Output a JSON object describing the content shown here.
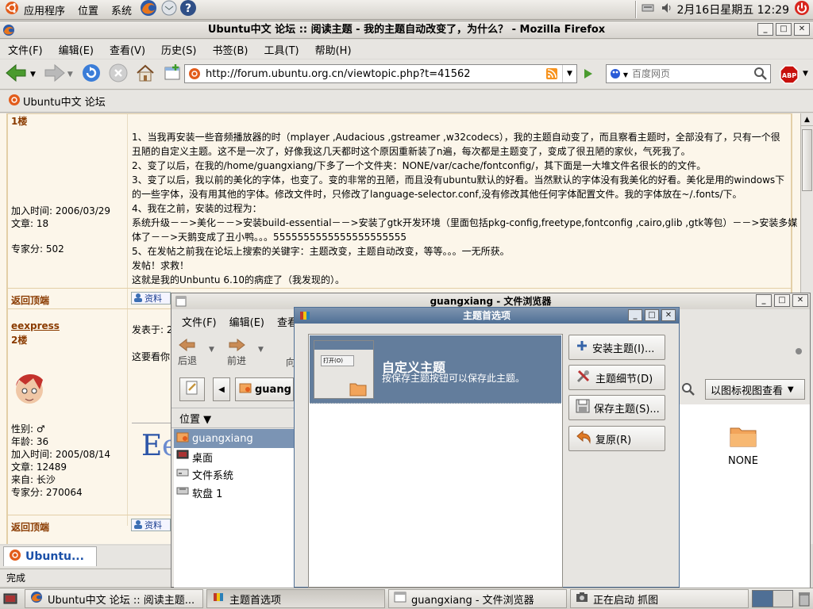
{
  "top_panel": {
    "menu_apps": "应用程序",
    "menu_places": "位置",
    "menu_system": "系统",
    "clock": "2月16日星期五 12:29"
  },
  "firefox": {
    "title": "Ubuntu中文 论坛 :: 阅读主题 - 我的主题自动改变了，为什么？ - Mozilla Firefox",
    "menus": [
      "文件(F)",
      "编辑(E)",
      "查看(V)",
      "历史(S)",
      "书签(B)",
      "工具(T)",
      "帮助(H)"
    ],
    "url": "http://forum.ubuntu.org.cn/viewtopic.php?t=41562",
    "search_placeholder": "百度网页",
    "bookmark": "Ubuntu中文 论坛",
    "tab_label": "Ubuntu...",
    "status": "完成"
  },
  "forum": {
    "post1": {
      "floor": "1楼",
      "join": "加入时间: 2006/03/29",
      "posts": "文章: 18",
      "score": "专家分: 502",
      "lines": [
        "1、当我再安装一些音频播放器的时（mplayer ,Audacious ,gstreamer ,w32codecs），我的主题自动变了，而且察看主题时，全部没有了，只有一个很",
        "丑陋的自定义主题。这不是一次了，好像我这几天都时这个原因重新装了n遍，每次都是主题变了，变成了很丑陋的家伙，气死我了。",
        "2、变了以后，在我的/home/guangxiang/下多了一个文件夹：NONE/var/cache/fontconfig/，其下面是一大堆文件名很长的的文件。",
        "3、变了以后，我以前的美化的字体，也变了。变的非常的丑陋，而且没有ubuntu默认的好看。当然默认的字体没有我美化的好看。美化是用的windows下",
        "的一些字体，没有用其他的字体。修改文件时，只修改了language-selector.conf,没有修改其他任何字体配置文件。我的字体放在~/.fonts/下。",
        "4、我在之前，安装的过程为：",
        "系统升级－－>美化－－>安装build-essential－－>安装了gtk开发环境（里面包括pkg-config,freetype,fontconfig ,cairo,glib ,gtk等包）－－>安装多媒",
        "体了－－>天鹅变成了丑小鸭。。。5555555555555555555555",
        "5、在发帖之前我在论坛上搜索的关键字：主题改变，主题自动改变，等等。。。一无所获。",
        "发帖！求救！",
        "这就是我的Unbuntu 6.10的病症了（我发现的）。"
      ],
      "back_top": "返回顶端",
      "profile_btn": "资料"
    },
    "post2": {
      "user": "eexpress",
      "floor": "2楼",
      "post_label": "发表于: 2",
      "preview": "这要看你",
      "gender": "性别: ♂",
      "age": "年龄: 36",
      "join": "加入时间: 2005/08/14",
      "posts": "文章: 12489",
      "from": "来自: 长沙",
      "score": "专家分: 270064",
      "back_top": "返回顶端",
      "profile_btn": "资料"
    }
  },
  "file_browser": {
    "title": "guangxiang - 文件浏览器",
    "menus": [
      "文件(F)",
      "编辑(E)",
      "查看"
    ],
    "back": "后退",
    "forward": "前进",
    "location_crumb": "guang",
    "view_mode": "以图标视图查看",
    "places_label": "位置",
    "places": [
      "guangxiang",
      "桌面",
      "文件系统",
      "软盘 1"
    ],
    "folder_name": "NONE"
  },
  "theme_dialog": {
    "title": "主题首选项",
    "theme_name": "自定义主题",
    "theme_desc": "按保存主题按钮可以保存此主题。",
    "thumb_label": "打开(O)",
    "buttons": [
      "安装主题(I)...",
      "主题细节(D)",
      "保存主题(S)...",
      "复原(R)"
    ]
  },
  "taskbar": {
    "tasks": [
      "Ubuntu中文 论坛 :: 阅读主题...",
      "主题首选项",
      "guangxiang - 文件浏览器",
      "正在启动 抓图"
    ]
  }
}
